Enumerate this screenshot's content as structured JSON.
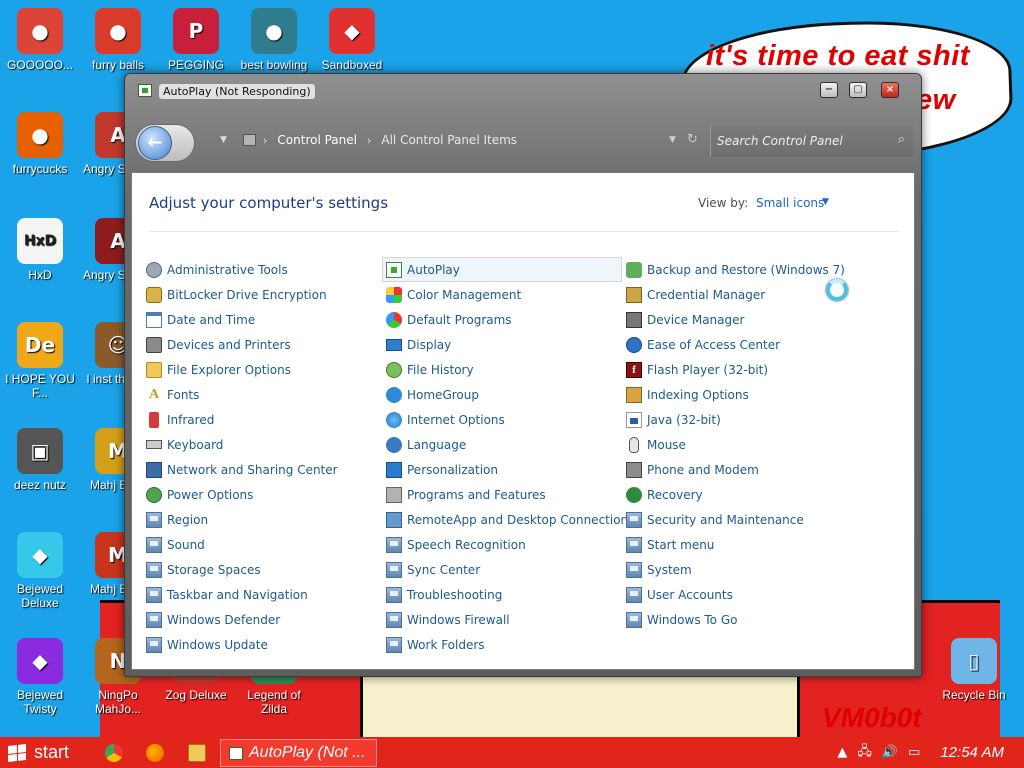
{
  "desktop": {
    "speech_bubble": [
      "it's time to eat shit",
      "ew"
    ],
    "watermark": "VM0b0t",
    "icons": [
      {
        "label": "GOOOOO...",
        "icon": "chrome-icon",
        "color": "#db4437",
        "glyph": "●"
      },
      {
        "label": "furry balls",
        "icon": "furry-balls-icon",
        "color": "#d93a2a",
        "glyph": "●"
      },
      {
        "label": "PEGGING",
        "icon": "peggle-icon",
        "color": "#c81f3a",
        "glyph": "P"
      },
      {
        "label": "best bowling",
        "icon": "bowling-icon",
        "color": "#2f7c8e",
        "glyph": "●"
      },
      {
        "label": "Sandboxed",
        "icon": "sandboxed-icon",
        "color": "#e03030",
        "glyph": "◆"
      },
      {
        "label": "furrycucks",
        "icon": "firefox-icon",
        "color": "#e66000",
        "glyph": "●"
      },
      {
        "label": "Angry Soy W",
        "icon": "angry-birds-icon",
        "color": "#c0392b",
        "glyph": "A"
      },
      {
        "label": "HxD",
        "icon": "hxd-icon",
        "color": "#f5f5f5",
        "glyph": "HxD"
      },
      {
        "label": "Angry Soy W",
        "icon": "angry-birds-2-icon",
        "color": "#8e1c1c",
        "glyph": "A"
      },
      {
        "label": "I HOPE YOU F...",
        "icon": "de-icon",
        "color": "#f0a818",
        "glyph": "De"
      },
      {
        "label": "I inst this by",
        "icon": "installer-icon",
        "color": "#8b5a2b",
        "glyph": "☺"
      },
      {
        "label": "deez nutz",
        "icon": "windows-icon",
        "color": "#555555",
        "glyph": "▣"
      },
      {
        "label": "Mahj Esca",
        "icon": "mahjong-icon",
        "color": "#d4a017",
        "glyph": "M"
      },
      {
        "label": "Bejewed Deluxe",
        "icon": "bejeweled-icon",
        "color": "#35c8e8",
        "glyph": "◆"
      },
      {
        "label": "Mahj Esca",
        "icon": "mahjong-2-icon",
        "color": "#c8341c",
        "glyph": "M"
      },
      {
        "label": "Bejewed Twisty",
        "icon": "bejeweled-twist-icon",
        "color": "#8a2be2",
        "glyph": "◆"
      },
      {
        "label": "NingPo MahJo...",
        "icon": "ningpo-icon",
        "color": "#b5651d",
        "glyph": "N"
      },
      {
        "label": "Zog Deluxe",
        "icon": "zog-icon",
        "color": "#c0392b",
        "glyph": "Z"
      },
      {
        "label": "Legend of Zilda",
        "icon": "zilda-icon",
        "color": "#2e8b57",
        "glyph": "Z"
      },
      {
        "label": "Recycle Bin",
        "icon": "recycle-bin-icon",
        "color": "#6fb6e8",
        "glyph": "▯"
      }
    ]
  },
  "window": {
    "title": "AutoPlay (Not Responding)",
    "minimize": "−",
    "maximize": "▢",
    "close": "×",
    "breadcrumb": [
      "Control Panel",
      "All Control Panel Items"
    ],
    "search_placeholder": "Search Control Panel",
    "heading": "Adjust your computer's settings",
    "view_by_label": "View by:",
    "view_by_value": "Small icons",
    "columns": [
      [
        {
          "label": "Administrative Tools",
          "icon": "ic-tools"
        },
        {
          "label": "BitLocker Drive Encryption",
          "icon": "ic-lock"
        },
        {
          "label": "Date and Time",
          "icon": "ic-cal"
        },
        {
          "label": "Devices and Printers",
          "icon": "ic-printer"
        },
        {
          "label": "File Explorer Options",
          "icon": "ic-folder"
        },
        {
          "label": "Fonts",
          "icon": "ic-font"
        },
        {
          "label": "Infrared",
          "icon": "ic-ir"
        },
        {
          "label": "Keyboard",
          "icon": "ic-kb"
        },
        {
          "label": "Network and Sharing Center",
          "icon": "ic-net"
        },
        {
          "label": "Power Options",
          "icon": "ic-power"
        },
        {
          "label": "Region",
          "icon": "ic-gen"
        },
        {
          "label": "Sound",
          "icon": "ic-gen"
        },
        {
          "label": "Storage Spaces",
          "icon": "ic-gen"
        },
        {
          "label": "Taskbar and Navigation",
          "icon": "ic-gen"
        },
        {
          "label": "Windows Defender",
          "icon": "ic-gen"
        },
        {
          "label": "Windows Update",
          "icon": "ic-gen"
        }
      ],
      [
        {
          "label": "AutoPlay",
          "icon": "ic-autoplay",
          "selected": true
        },
        {
          "label": "Color Management",
          "icon": "ic-color"
        },
        {
          "label": "Default Programs",
          "icon": "ic-default"
        },
        {
          "label": "Display",
          "icon": "ic-display"
        },
        {
          "label": "File History",
          "icon": "ic-history"
        },
        {
          "label": "HomeGroup",
          "icon": "ic-home"
        },
        {
          "label": "Internet Options",
          "icon": "ic-globe"
        },
        {
          "label": "Language",
          "icon": "ic-lang"
        },
        {
          "label": "Personalization",
          "icon": "ic-person"
        },
        {
          "label": "Programs and Features",
          "icon": "ic-programs"
        },
        {
          "label": "RemoteApp and Desktop Connections",
          "icon": "ic-remote"
        },
        {
          "label": "Speech Recognition",
          "icon": "ic-gen"
        },
        {
          "label": "Sync Center",
          "icon": "ic-gen"
        },
        {
          "label": "Troubleshooting",
          "icon": "ic-gen"
        },
        {
          "label": "Windows Firewall",
          "icon": "ic-gen"
        },
        {
          "label": "Work Folders",
          "icon": "ic-gen"
        }
      ],
      [
        {
          "label": "Backup and Restore (Windows 7)",
          "icon": "ic-backup"
        },
        {
          "label": "Credential Manager",
          "icon": "ic-cred"
        },
        {
          "label": "Device Manager",
          "icon": "ic-dev"
        },
        {
          "label": "Ease of Access Center",
          "icon": "ic-ease"
        },
        {
          "label": "Flash Player (32-bit)",
          "icon": "ic-flash"
        },
        {
          "label": "Indexing Options",
          "icon": "ic-index"
        },
        {
          "label": "Java (32-bit)",
          "icon": "ic-java"
        },
        {
          "label": "Mouse",
          "icon": "ic-mouse"
        },
        {
          "label": "Phone and Modem",
          "icon": "ic-phone"
        },
        {
          "label": "Recovery",
          "icon": "ic-recovery"
        },
        {
          "label": "Security and Maintenance",
          "icon": "ic-gen"
        },
        {
          "label": "Start menu",
          "icon": "ic-gen"
        },
        {
          "label": "System",
          "icon": "ic-gen"
        },
        {
          "label": "User Accounts",
          "icon": "ic-gen"
        },
        {
          "label": "Windows To Go",
          "icon": "ic-gen"
        }
      ]
    ]
  },
  "taskbar": {
    "start_label": "start",
    "task_label": "AutoPlay (Not ...",
    "clock": "12:54 AM"
  }
}
